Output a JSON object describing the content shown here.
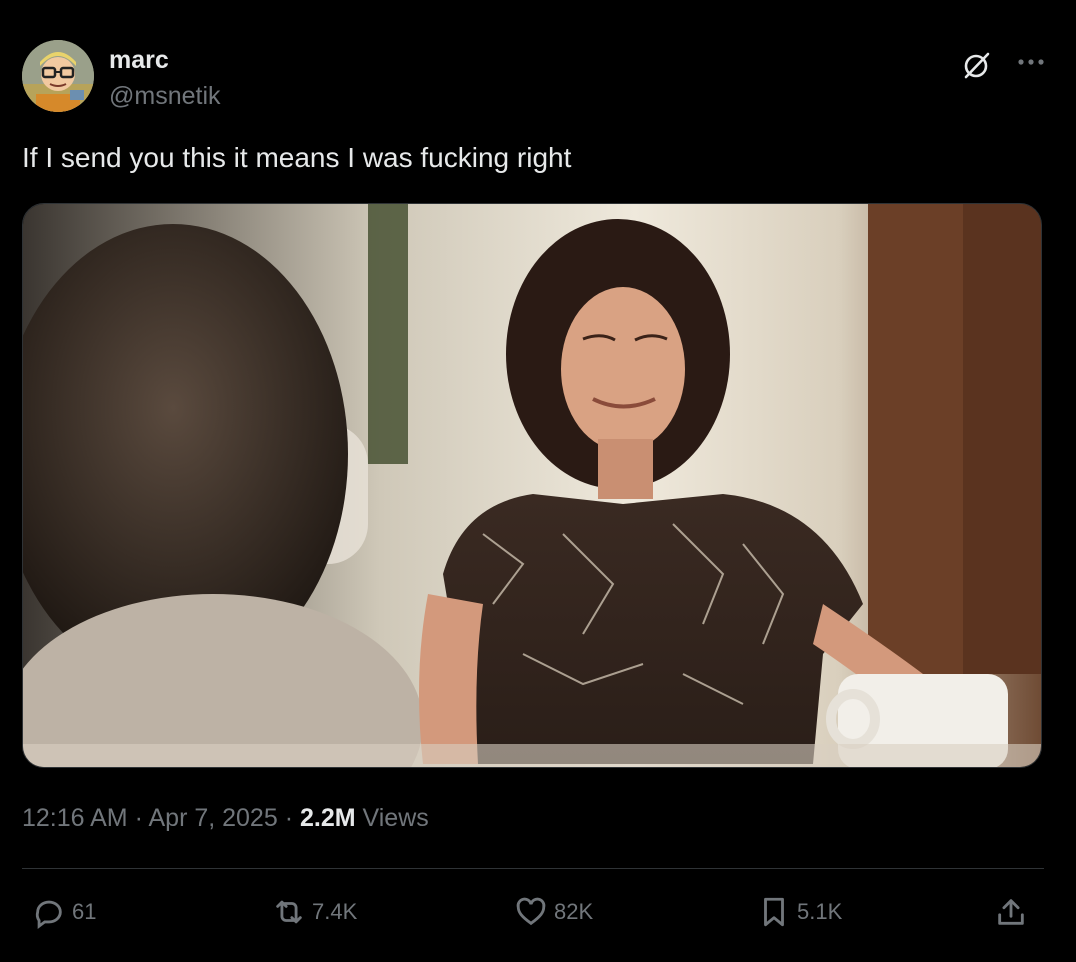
{
  "author": {
    "display_name": "marc",
    "handle": "@msnetik",
    "avatar_icon": "cartoon-avatar-icon"
  },
  "header_actions": {
    "grok_icon": "grok-icon",
    "more_icon": "more-dots-icon"
  },
  "tweet": {
    "text": "If I send you this it means I was fucking right"
  },
  "media": {
    "kind": "video-still",
    "description_icon": "media-image"
  },
  "meta": {
    "time": "12:16 AM",
    "separator1": " · ",
    "date": "Apr 7, 2025",
    "separator2": " · ",
    "views_count": "2.2M",
    "views_label": " Views"
  },
  "actions": {
    "replies": {
      "icon": "reply-icon",
      "count": "61"
    },
    "reposts": {
      "icon": "repost-icon",
      "count": "7.4K"
    },
    "likes": {
      "icon": "like-icon",
      "count": "82K"
    },
    "bookmarks": {
      "icon": "bookmark-icon",
      "count": "5.1K"
    },
    "share": {
      "icon": "share-icon"
    }
  },
  "colors": {
    "background": "#000000",
    "primary_text": "#e7e9ea",
    "secondary_text": "#71767b",
    "divider": "#2f3336"
  }
}
